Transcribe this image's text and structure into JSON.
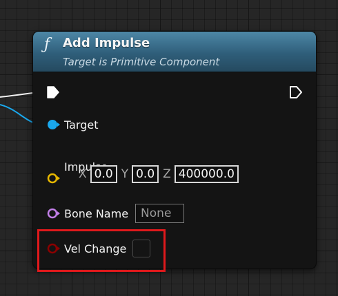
{
  "node": {
    "function_icon": "ƒ",
    "title": "Add Impulse",
    "subtitle": "Target is Primitive Component"
  },
  "pins": {
    "exec_in_icon": "exec-in-icon",
    "exec_out_icon": "exec-out-icon",
    "target": {
      "label": "Target",
      "icon": "object-pin-icon",
      "color": "#1aa7ec"
    },
    "impulse": {
      "label": "Impulse",
      "icon": "vector-pin-icon",
      "color": "#e8b800",
      "x_label": "X",
      "x_value": "0.0",
      "y_label": "Y",
      "y_value": "0.0",
      "z_label": "Z",
      "z_value": "400000.0"
    },
    "bone_name": {
      "label": "Bone Name",
      "icon": "name-pin-icon",
      "color": "#c27fe8",
      "value": "None"
    },
    "vel_change": {
      "label": "Vel Change",
      "icon": "bool-pin-icon",
      "color": "#8c0000",
      "checked": false
    }
  },
  "highlight_color": "#e0191c"
}
